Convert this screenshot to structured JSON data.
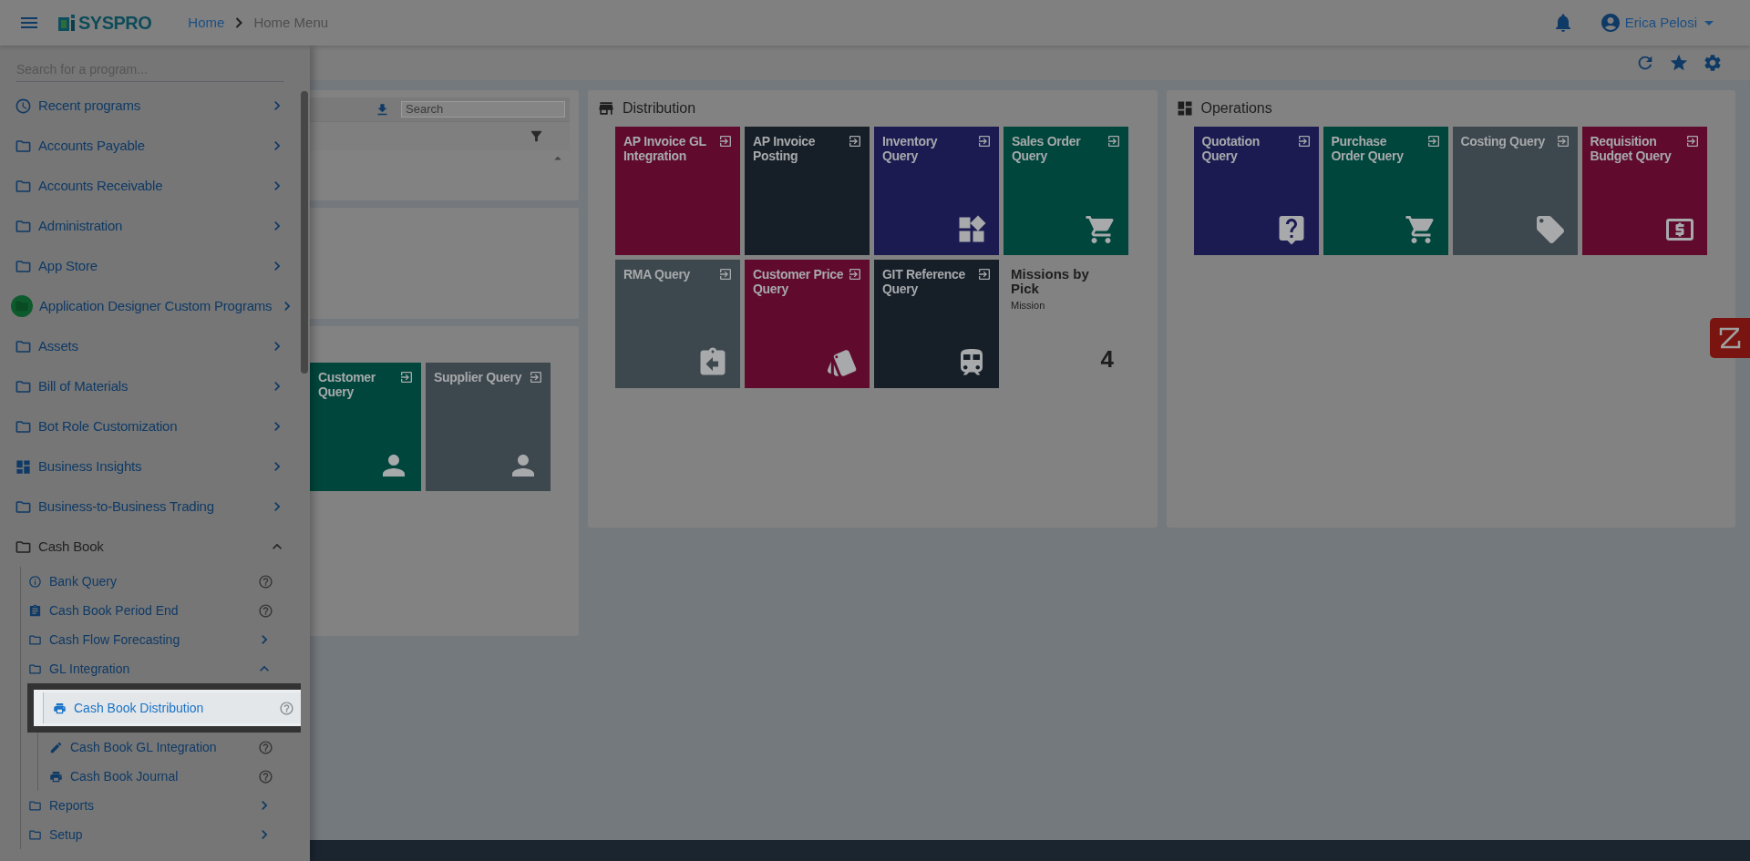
{
  "header": {
    "logo": "SYSPRO",
    "breadcrumb": [
      {
        "label": "Home",
        "kind": "link"
      },
      {
        "label": "Home Menu",
        "kind": "current"
      }
    ],
    "user": "Erica Pelosi"
  },
  "sidebar": {
    "search": {
      "placeholder": "Search for a program..."
    },
    "items": [
      {
        "label": "Recent programs",
        "kind": "recent",
        "expanded": false
      },
      {
        "label": "Accounts Payable",
        "kind": "folder",
        "expanded": false
      },
      {
        "label": "Accounts Receivable",
        "kind": "folder",
        "expanded": false
      },
      {
        "label": "Administration",
        "kind": "folder",
        "expanded": false
      },
      {
        "label": "App Store",
        "kind": "folder",
        "expanded": false
      },
      {
        "label": "Application Designer Custom Programs",
        "kind": "designer",
        "expanded": false
      },
      {
        "label": "Assets",
        "kind": "folder",
        "expanded": false
      },
      {
        "label": "Bill of Materials",
        "kind": "folder",
        "expanded": false
      },
      {
        "label": "Bot Role Customization",
        "kind": "folder",
        "expanded": false
      },
      {
        "label": "Business Insights",
        "kind": "insights",
        "expanded": false
      },
      {
        "label": "Business-to-Business Trading",
        "kind": "folder",
        "expanded": false
      },
      {
        "label": "Cash Book",
        "kind": "folder",
        "expanded": true,
        "children": [
          {
            "label": "Bank Query",
            "kind": "query",
            "selected": false
          },
          {
            "label": "Cash Book Period End",
            "kind": "task",
            "selected": false
          },
          {
            "label": "Cash Flow Forecasting",
            "kind": "folder",
            "expanded": false
          },
          {
            "label": "GL Integration",
            "kind": "folder",
            "expanded": true,
            "children": [
              {
                "label": "Cash Book Distribution",
                "kind": "print",
                "selected": true
              },
              {
                "label": "Cash Book GL Integration",
                "kind": "posting",
                "selected": false
              },
              {
                "label": "Cash Book Journal",
                "kind": "print",
                "selected": false
              }
            ]
          },
          {
            "label": "Reports",
            "kind": "folder",
            "expanded": false
          },
          {
            "label": "Setup",
            "kind": "folder",
            "expanded": false
          }
        ]
      }
    ]
  },
  "left_panels": {
    "search": {
      "placeholder": "Search"
    },
    "tiles": [
      {
        "title": "Customer Query",
        "kind": "contact",
        "color": "#00463c"
      },
      {
        "title": "Supplier Query",
        "kind": "contact",
        "color": "#3d474e"
      }
    ]
  },
  "distribution": {
    "title": "Distribution",
    "tiles": [
      {
        "title": "AP Invoice GL Integration",
        "kind": "integration",
        "color": "#600a2d"
      },
      {
        "title": "AP Invoice Posting",
        "kind": "posting",
        "color": "#161e28"
      },
      {
        "title": "Inventory Query",
        "kind": "inventory",
        "color": "#1b1b52"
      },
      {
        "title": "Sales Order Query",
        "kind": "sales",
        "color": "#00463c"
      },
      {
        "title": "RMA Query",
        "kind": "rma",
        "color": "#3d474e"
      },
      {
        "title": "Customer Price Query",
        "kind": "price",
        "color": "#600a2d"
      },
      {
        "title": "GIT Reference Query",
        "kind": "transit",
        "color": "#161e28"
      },
      {
        "title": "Missions by Pick",
        "kind": "kpi",
        "subtitle": "Mission",
        "value": "4"
      }
    ]
  },
  "operations": {
    "title": "Operations",
    "tiles": [
      {
        "title": "Quotation Query",
        "kind": "quotation",
        "color": "#1b1b52"
      },
      {
        "title": "Purchase Order Query",
        "kind": "purchase",
        "color": "#00463c"
      },
      {
        "title": "Costing Query",
        "kind": "costing",
        "color": "#3d474e"
      },
      {
        "title": "Requisition Budget Query",
        "kind": "budget",
        "color": "#600a2d"
      }
    ]
  }
}
